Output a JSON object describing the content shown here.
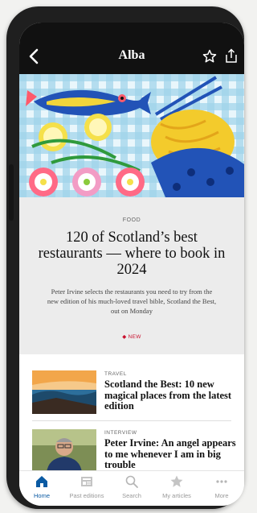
{
  "header": {
    "title": "Alba"
  },
  "lead": {
    "kicker": "FOOD",
    "headline": "120 of Scotland’s best restaurants — where to book in 2024",
    "standfirst": "Peter Irvine selects the restaurants you need to try from the new edition of his much-loved travel bible, Scotland the Best, out on Monday",
    "badge": "◆ NEW"
  },
  "articles": [
    {
      "kicker": "TRAVEL",
      "headline": "Scotland the Best: 10 new magical places from the latest edition"
    },
    {
      "kicker": "INTERVIEW",
      "headline": "Peter Irvine: An angel appears to me whenever I am in big trouble"
    }
  ],
  "nav": [
    {
      "label": "Home",
      "icon": "home-icon",
      "active": true
    },
    {
      "label": "Past editions",
      "icon": "newspaper-icon",
      "active": false
    },
    {
      "label": "Search",
      "icon": "search-icon",
      "active": false
    },
    {
      "label": "My articles",
      "icon": "star-icon",
      "active": false
    },
    {
      "label": "More",
      "icon": "more-icon",
      "active": false
    }
  ],
  "colors": {
    "accent": "#0a5aa3",
    "badge": "#c8102e",
    "topbar": "#111111"
  }
}
